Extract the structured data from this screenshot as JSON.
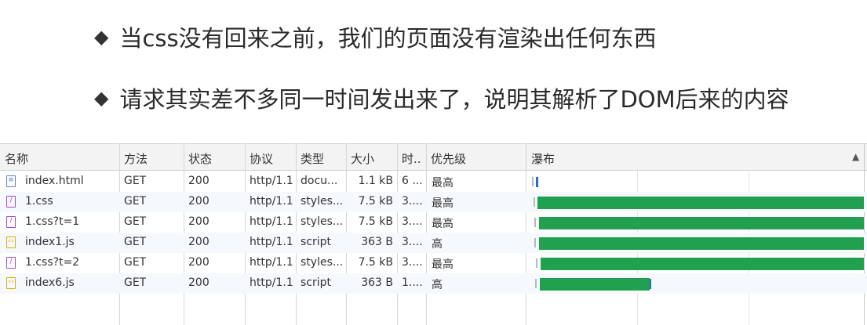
{
  "slide": {
    "bullet1": "当css没有回来之前，我们的页面没有渲染出任何东西",
    "bullet2": "请求其实差不多同一时间发出来了，说明其解析了DOM后来的内容",
    "bullet_icon": "diamond-bullet-icon"
  },
  "network": {
    "columns": {
      "name": "名称",
      "method": "方法",
      "status": "状态",
      "protocol": "协议",
      "type": "类型",
      "size": "大小",
      "time": "时..",
      "priority": "优先级",
      "waterfall": "瀑布"
    },
    "sort_icon": "sort-up-icon",
    "rows": [
      {
        "name": "index.html",
        "method": "GET",
        "status": "200",
        "protocol": "http/1.1",
        "type": "docu...",
        "size": "1.1 kB",
        "time": "6 ...",
        "priority": "最高",
        "icon": "html-file-icon"
      },
      {
        "name": "1.css",
        "method": "GET",
        "status": "200",
        "protocol": "http/1.1",
        "type": "styles...",
        "size": "7.5 kB",
        "time": "3....",
        "priority": "最高",
        "icon": "css-file-icon"
      },
      {
        "name": "1.css?t=1",
        "method": "GET",
        "status": "200",
        "protocol": "http/1.1",
        "type": "styles...",
        "size": "7.5 kB",
        "time": "3....",
        "priority": "最高",
        "icon": "css-file-icon"
      },
      {
        "name": "index1.js",
        "method": "GET",
        "status": "200",
        "protocol": "http/1.1",
        "type": "script",
        "size": "363 B",
        "time": "3....",
        "priority": "高",
        "icon": "js-file-icon"
      },
      {
        "name": "1.css?t=2",
        "method": "GET",
        "status": "200",
        "protocol": "http/1.1",
        "type": "styles...",
        "size": "7.5 kB",
        "time": "3....",
        "priority": "最高",
        "icon": "css-file-icon"
      },
      {
        "name": "index6.js",
        "method": "GET",
        "status": "200",
        "protocol": "http/1.1",
        "type": "script",
        "size": "363 B",
        "time": "1....",
        "priority": "高",
        "icon": "js-file-icon"
      }
    ],
    "colors": {
      "bar": "#21a04f",
      "tick": "#1e6fd0"
    }
  }
}
